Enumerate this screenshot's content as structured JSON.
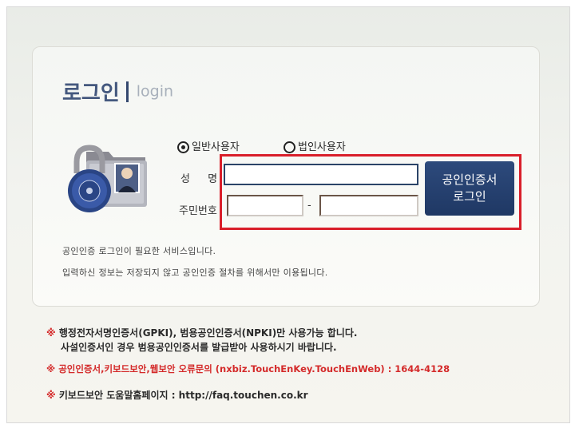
{
  "title": {
    "korean": "로그인",
    "english": "login"
  },
  "user_type": {
    "options": [
      {
        "label": "일반사용자",
        "selected": true
      },
      {
        "label": "법인사용자",
        "selected": false
      }
    ]
  },
  "form": {
    "name_label": "성 명",
    "name_value": "",
    "id_label": "주민번호",
    "id_part1": "",
    "id_part2": "",
    "id_separator": "-"
  },
  "cert_login_button": {
    "line1": "공인인증서",
    "line2": "로그인"
  },
  "info": {
    "line1": "공인인증 로그인이 필요한 서비스입니다.",
    "line2": "입력하신 정보는 저장되지 않고 공인인증 절차를 위해서만 이용됩니다."
  },
  "notices": {
    "bullet": "※",
    "cert_notice_line1": "행정전자서명인증서(GPKI), 범용공인인증서(NPKI)만 사용가능 합니다.",
    "cert_notice_line2": "사설인증서인 경우 범용공인인증서를 발급받아 사용하시기 바랍니다.",
    "support_notice": "공인인증서,키보드보안,웹보안 오류문의 (nxbiz.TouchEnKey.TouchEnWeb) : 1644-4128",
    "keyboard_help": "키보드보안 도움말홈페이지 : http://faq.touchen.co.kr"
  },
  "colors": {
    "accent": "#1f3864",
    "highlight": "#d91e2a",
    "notice_red": "#d42a2a"
  }
}
